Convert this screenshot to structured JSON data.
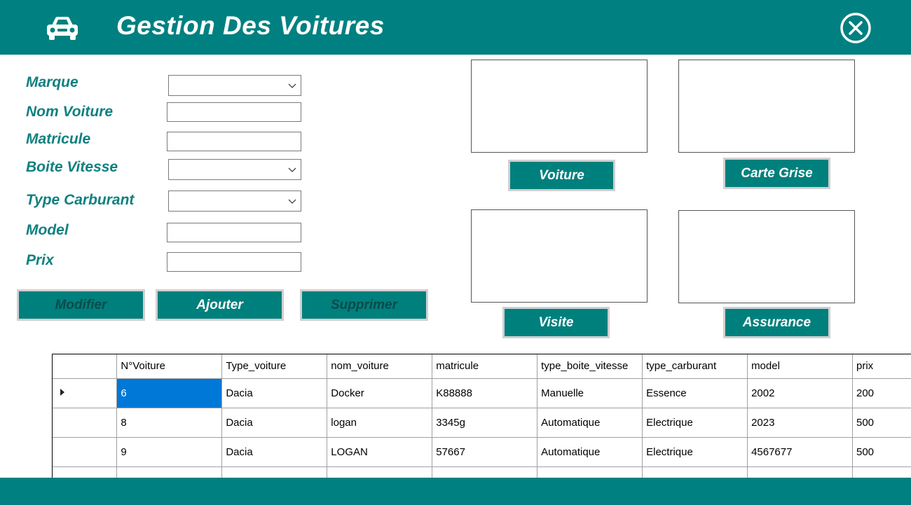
{
  "header": {
    "title": "Gestion Des Voitures",
    "icon": "car-icon",
    "close_icon": "close-circle-icon"
  },
  "form": {
    "fields": [
      {
        "label": "Marque",
        "kind": "combobox",
        "value": ""
      },
      {
        "label": "Nom Voiture",
        "kind": "textbox",
        "value": ""
      },
      {
        "label": "Matricule",
        "kind": "textbox",
        "value": ""
      },
      {
        "label": "Boite Vitesse",
        "kind": "combobox",
        "value": ""
      },
      {
        "label": "Type Carburant",
        "kind": "combobox",
        "value": ""
      },
      {
        "label": "Model",
        "kind": "textbox",
        "value": ""
      },
      {
        "label": "Prix",
        "kind": "textbox",
        "value": ""
      }
    ],
    "buttons": {
      "modifier": "Modifier",
      "ajouter": "Ajouter",
      "supprimer": "Supprimer"
    }
  },
  "images": {
    "voiture": "Voiture",
    "carte_grise": "Carte Grise",
    "visite": "Visite",
    "assurance": "Assurance"
  },
  "grid": {
    "columns": [
      "N°Voiture",
      "Type_voiture",
      "nom_voiture",
      "matricule",
      "type_boite_vitesse",
      "type_carburant",
      "model",
      "prix"
    ],
    "rows": [
      [
        "6",
        "Dacia",
        "Docker",
        "K88888",
        "Manuelle",
        "Essence",
        "2002",
        "200"
      ],
      [
        "8",
        "Dacia",
        "logan",
        "3345g",
        "Automatique",
        "Electrique",
        "2023",
        "500"
      ],
      [
        "9",
        "Dacia",
        "LOGAN",
        "57667",
        "Automatique",
        "Electrique",
        "4567677",
        "500"
      ]
    ],
    "selected_row_marker": "row-pointer-icon"
  },
  "colors": {
    "header_bg": "#008080",
    "label": "#0f8080",
    "button_bg": "#00807d",
    "selection": "#0078d7"
  }
}
